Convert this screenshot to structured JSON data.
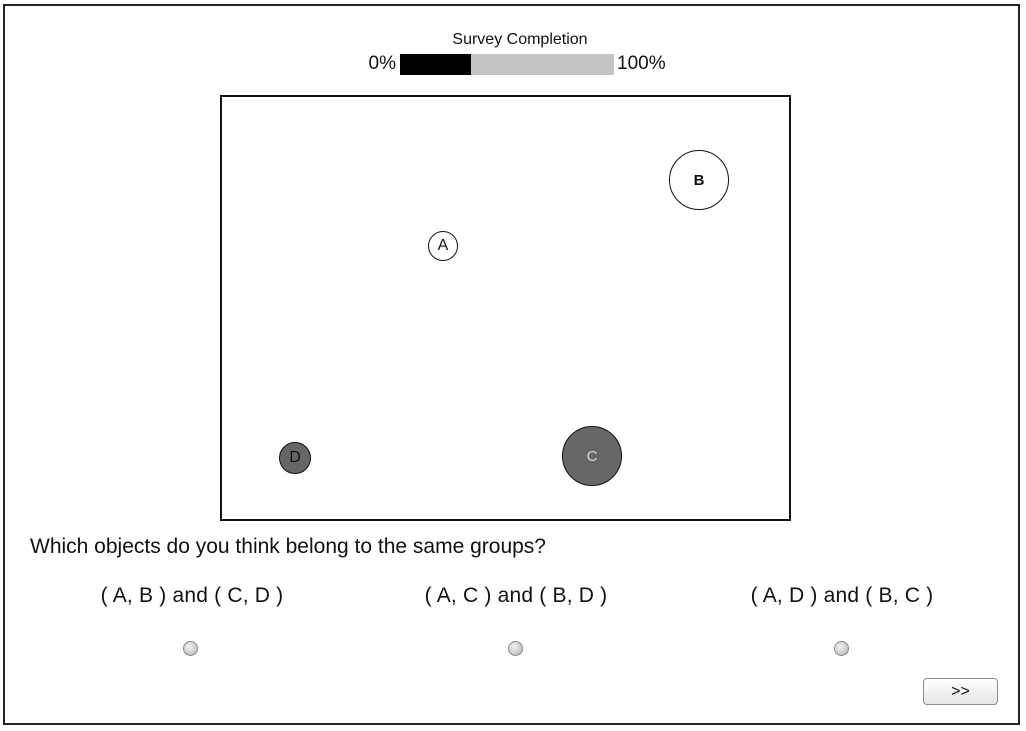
{
  "progress": {
    "title": "Survey Completion",
    "min_label": "0%",
    "max_label": "100%",
    "completion_fraction": 0.33,
    "fill_color": "#000000",
    "track_color": "#c4c4c4"
  },
  "board": {
    "objects": [
      {
        "label": "A",
        "fill": "#ffffff"
      },
      {
        "label": "B",
        "fill": "#ffffff"
      },
      {
        "label": "C",
        "fill": "#666666"
      },
      {
        "label": "D",
        "fill": "#666666"
      }
    ]
  },
  "question": {
    "text": "Which objects do you think belong to the same groups?",
    "options": [
      {
        "label": "( A, B ) and ( C, D )"
      },
      {
        "label": "( A, C ) and ( B, D )"
      },
      {
        "label": "( A, D ) and ( B, C )"
      }
    ]
  },
  "navigation": {
    "next_label": ">>"
  }
}
